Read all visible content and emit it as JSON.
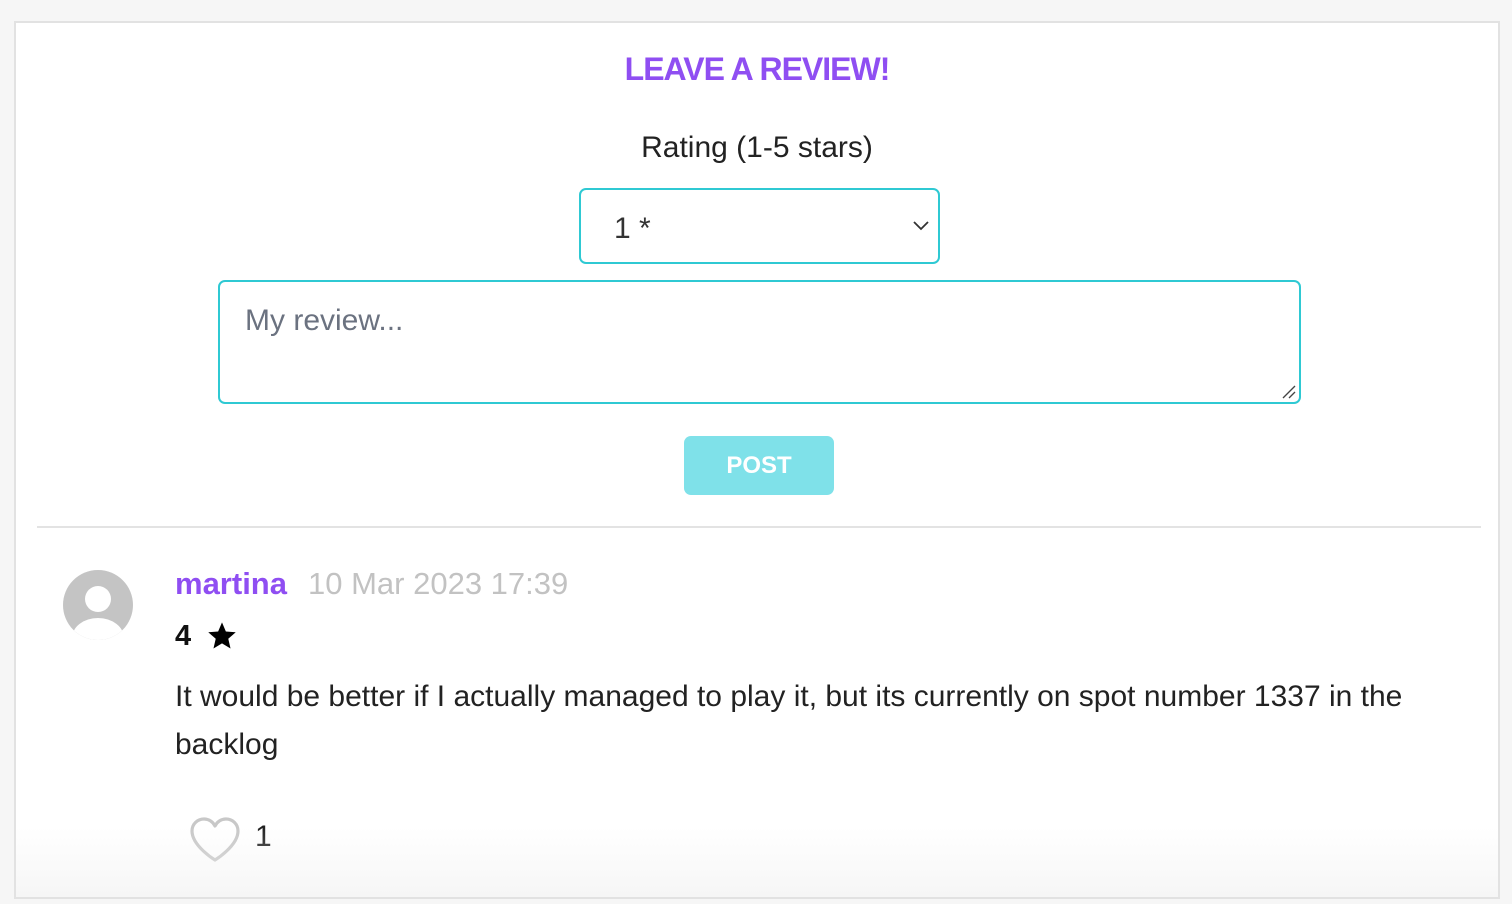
{
  "form": {
    "title": "LEAVE A REVIEW!",
    "rating_label": "Rating (1-5 stars)",
    "rating_selected": "1 *",
    "review_placeholder": "My review...",
    "post_label": "POST"
  },
  "reviews": [
    {
      "author": "martina",
      "timestamp": "10 Mar 2023 17:39",
      "rating": "4",
      "text": "It would be better if I actually managed to play it, but its currently on spot number 1337 in the backlog",
      "likes": "1"
    }
  ],
  "icons": {
    "avatar": "user-avatar-icon",
    "star": "star-icon",
    "like": "heart-icon",
    "select": "chevron-down-icon"
  },
  "colors": {
    "accent_purple": "#8f4ef2",
    "input_border": "#2fc9d3",
    "post_button_bg": "#7fe1e9",
    "timestamp_gray": "#c2c2c2"
  }
}
